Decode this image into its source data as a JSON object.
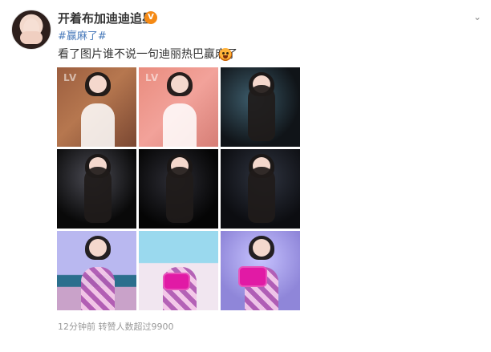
{
  "post": {
    "username": "开着布加迪迪追星",
    "badge": "V",
    "topic": "#赢麻了#",
    "text": "看了图片谁不说一句迪丽热巴赢麻了",
    "meta": "12分钟前 转赞人数超过9900"
  },
  "ui": {
    "more": "⌄"
  },
  "images": {
    "watermarks": [
      "LV",
      "LV"
    ]
  }
}
